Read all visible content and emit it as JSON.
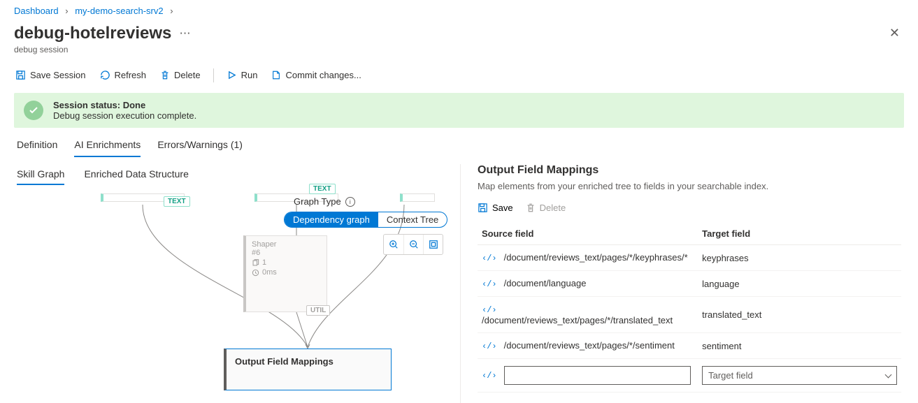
{
  "breadcrumb": {
    "item1": "Dashboard",
    "item2": "my-demo-search-srv2"
  },
  "page": {
    "title": "debug-hotelreviews",
    "subtitle": "debug session"
  },
  "toolbar": {
    "save": "Save Session",
    "refresh": "Refresh",
    "delete": "Delete",
    "run": "Run",
    "commit": "Commit changes..."
  },
  "status": {
    "line1": "Session status: Done",
    "line2": "Debug session execution complete."
  },
  "tabs": {
    "definition": "Definition",
    "ai": "AI Enrichments",
    "errors": "Errors/Warnings (1)"
  },
  "subtabs": {
    "skill": "Skill Graph",
    "enriched": "Enriched Data Structure"
  },
  "graph": {
    "typeLabel": "Graph Type",
    "dependency": "Dependency graph",
    "context": "Context Tree",
    "textBadge1": "TEXT",
    "textBadge2": "TEXT",
    "shaperTitle": "Shaper",
    "shaperNum": "#6",
    "shaperCount": "1",
    "shaperTime": "0ms",
    "utilBadge": "UTIL",
    "outputNode": "Output Field Mappings"
  },
  "panel": {
    "title": "Output Field Mappings",
    "desc": "Map elements from your enriched tree to fields in your searchable index.",
    "save": "Save",
    "delete": "Delete",
    "sourceHeader": "Source field",
    "targetHeader": "Target field",
    "targetPlaceholder": "Target field",
    "rows": [
      {
        "src": "/document/reviews_text/pages/*/keyphrases/*",
        "tgt": "keyphrases"
      },
      {
        "src": "/document/language",
        "tgt": "language"
      },
      {
        "src": "/document/reviews_text/pages/*/translated_text",
        "tgt": "translated_text"
      },
      {
        "src": "/document/reviews_text/pages/*/sentiment",
        "tgt": "sentiment"
      }
    ]
  }
}
